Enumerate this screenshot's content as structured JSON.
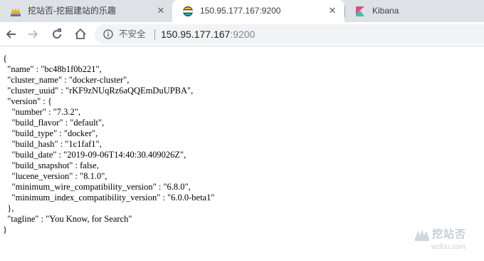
{
  "tabs": [
    {
      "title": "挖站否-挖掘建站的乐趣",
      "icon": "wzfou-logo-icon",
      "active": false
    },
    {
      "title": "150.95.177.167:9200",
      "icon": "elastic-logo-icon",
      "active": true
    },
    {
      "title": "Kibana",
      "icon": "kibana-logo-icon",
      "active": false
    }
  ],
  "toolbar": {
    "security_label": "不安全",
    "url_host": "150.95.177.167",
    "url_port": ":9200"
  },
  "response": {
    "name": "bc48b1f0b221",
    "cluster_name": "docker-cluster",
    "cluster_uuid": "rKF9zNUqRz6aQQEmDuUPBA",
    "version": {
      "number": "7.3.2",
      "build_flavor": "default",
      "build_type": "docker",
      "build_hash": "1c1faf1",
      "build_date": "2019-09-06T14:40:30.409026Z",
      "build_snapshot": false,
      "lucene_version": "8.1.0",
      "minimum_wire_compatibility_version": "6.8.0",
      "minimum_index_compatibility_version": "6.0.0-beta1"
    },
    "tagline": "You Know, for Search"
  },
  "watermark": {
    "brand": "挖站否",
    "domain": "wzfou.com"
  },
  "colors": {
    "tabstrip_bg": "#dee1e6",
    "omnibox_bg": "#f1f3f4",
    "kibana_pink": "#e8488b",
    "kibana_teal": "#3ebeb0",
    "elastic_yellow": "#fec514",
    "elastic_teal": "#00bfb3"
  }
}
